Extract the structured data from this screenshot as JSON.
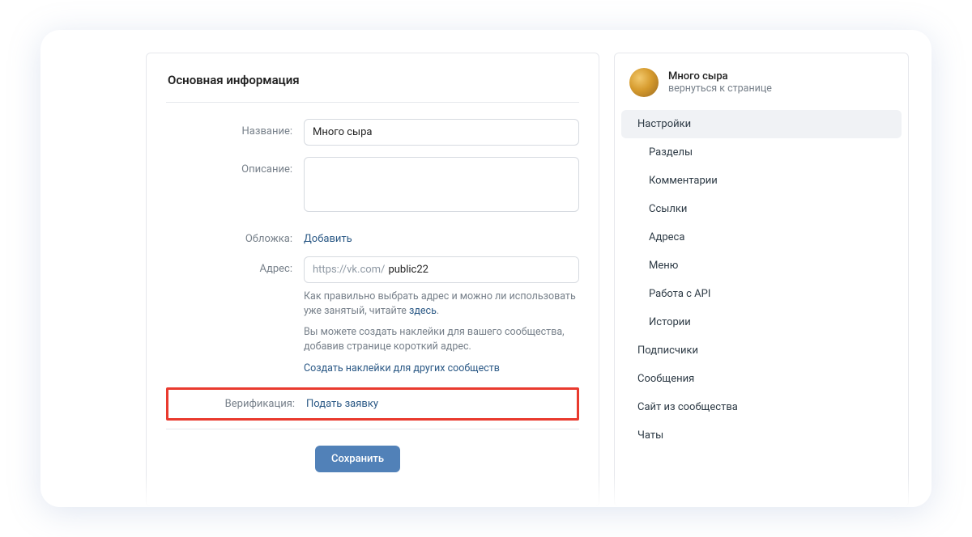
{
  "main": {
    "title": "Основная информация",
    "name_label": "Название:",
    "name_value": "Много сыра",
    "desc_label": "Описание:",
    "desc_value": "",
    "cover_label": "Обложка:",
    "cover_action": "Добавить",
    "addr_label": "Адрес:",
    "addr_prefix": "https://vk.com/",
    "addr_value": "public22",
    "addr_hint1_a": "Как правильно выбрать адрес и можно ли использовать уже занятый, читайте ",
    "addr_hint1_link": "здесь",
    "addr_hint1_b": ".",
    "addr_hint2": "Вы можете создать наклейки для вашего сообщества, добавив странице короткий адрес.",
    "addr_hint3": "Создать наклейки для других сообществ",
    "verif_label": "Верификация:",
    "verif_action": "Подать заявку",
    "save": "Сохранить"
  },
  "side": {
    "community_name": "Много сыра",
    "back_link": "вернуться к странице",
    "menu": [
      {
        "label": "Настройки",
        "sub": false,
        "active": true
      },
      {
        "label": "Разделы",
        "sub": true,
        "active": false
      },
      {
        "label": "Комментарии",
        "sub": true,
        "active": false
      },
      {
        "label": "Ссылки",
        "sub": true,
        "active": false
      },
      {
        "label": "Адреса",
        "sub": true,
        "active": false
      },
      {
        "label": "Меню",
        "sub": true,
        "active": false
      },
      {
        "label": "Работа с API",
        "sub": true,
        "active": false
      },
      {
        "label": "Истории",
        "sub": true,
        "active": false
      },
      {
        "label": "Подписчики",
        "sub": false,
        "active": false
      },
      {
        "label": "Сообщения",
        "sub": false,
        "active": false
      },
      {
        "label": "Сайт из сообщества",
        "sub": false,
        "active": false
      },
      {
        "label": "Чаты",
        "sub": false,
        "active": false
      }
    ]
  }
}
